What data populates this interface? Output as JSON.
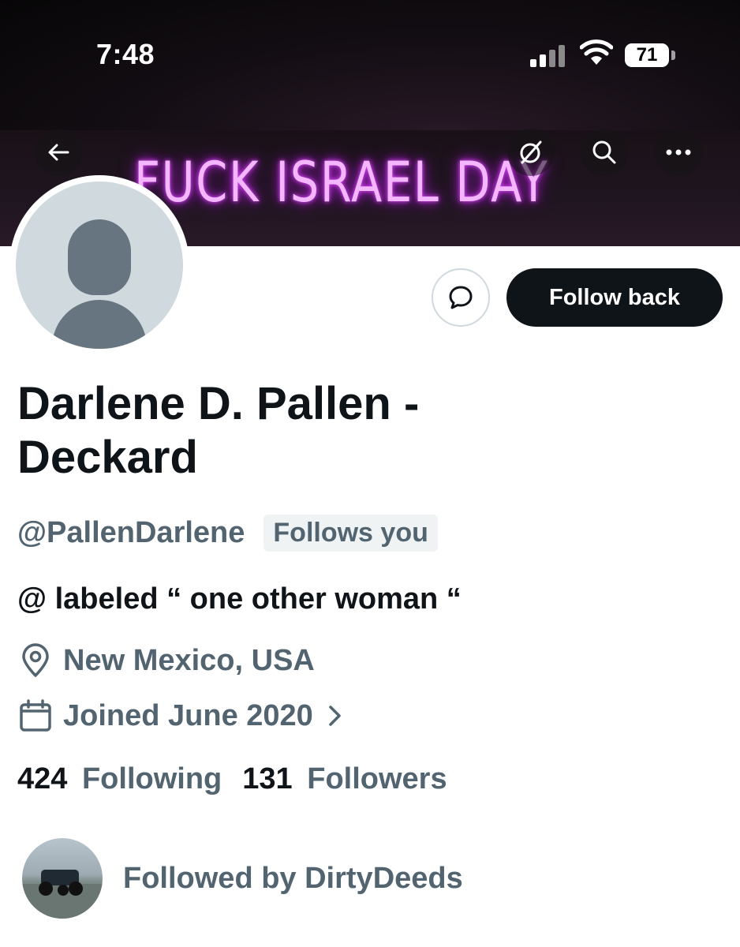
{
  "status_bar": {
    "time": "7:48",
    "battery": "71"
  },
  "banner": {
    "text": "FUCK ISRAEL DAY"
  },
  "header_icons": [
    "back-arrow-icon",
    "grok-icon",
    "search-icon",
    "more-icon"
  ],
  "actions": {
    "message_icon": "message-bubble-icon",
    "follow_label": "Follow back"
  },
  "profile": {
    "name": "Darlene D. Pallen - Deckard",
    "handle": "@PallenDarlene",
    "follows_you": "Follows you",
    "bio": "@ labeled “ one other woman “",
    "location": "New Mexico, USA",
    "joined": "Joined June 2020"
  },
  "stats": {
    "following_count": "424",
    "following_label": "Following",
    "followers_count": "131",
    "followers_label": "Followers"
  },
  "followed_by": {
    "text": "Followed by DirtyDeeds"
  },
  "colors": {
    "primary_text": "#0f1419",
    "secondary_text": "#536471",
    "button_bg": "#0f1419",
    "neon": "#e04cff"
  }
}
